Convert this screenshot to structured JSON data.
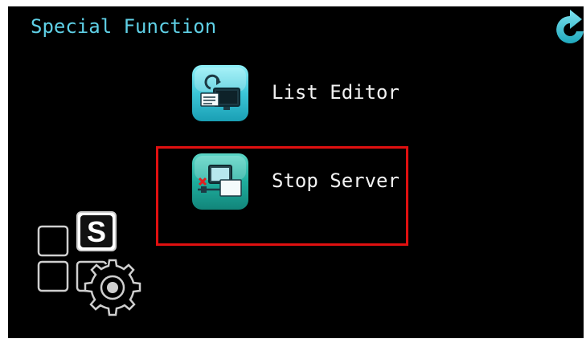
{
  "header": {
    "title": "Special Function",
    "back_icon": "back-arrow-icon"
  },
  "menu": {
    "items": [
      {
        "label": "List Editor",
        "icon": "list-editor-icon"
      },
      {
        "label": "Stop Server",
        "icon": "stop-server-icon",
        "highlighted": true
      }
    ]
  },
  "logo": {
    "letter": "S",
    "icon": "special-function-logo-icon"
  },
  "colors": {
    "title": "#5fd0e6",
    "accent": "#3cc6d8",
    "highlight": "#e01010",
    "background": "#000000",
    "text": "#f2f2f2"
  }
}
